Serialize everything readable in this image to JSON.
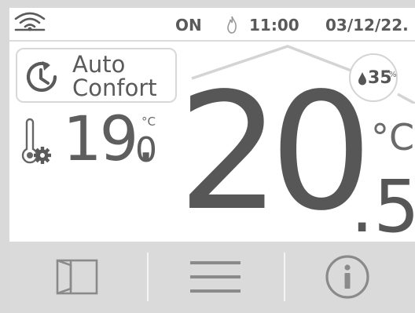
{
  "status": {
    "wifi_icon": "wifi-icon",
    "mode_state": "ON",
    "flame_icon": "flame-icon",
    "time": "11:00",
    "date": "03/12/22."
  },
  "mode": {
    "icon": "clock-rotate-icon",
    "line1": "Auto",
    "line2": "Confort"
  },
  "setpoint": {
    "icon": "thermometer-gear-icon",
    "integer": "19.",
    "decimal": "0",
    "unit": "°C"
  },
  "humidity": {
    "icon": "water-drop-icon",
    "value": "35",
    "unit": "%"
  },
  "current_temperature": {
    "integer": "20",
    "decimal": ".5",
    "unit": "°C"
  },
  "nav": {
    "items": [
      {
        "icon": "room-door-icon"
      },
      {
        "icon": "menu-icon"
      },
      {
        "icon": "info-icon"
      }
    ]
  },
  "colors": {
    "text": "#575757",
    "nav_background": "#dadada",
    "outline": "#d8d8d8"
  }
}
